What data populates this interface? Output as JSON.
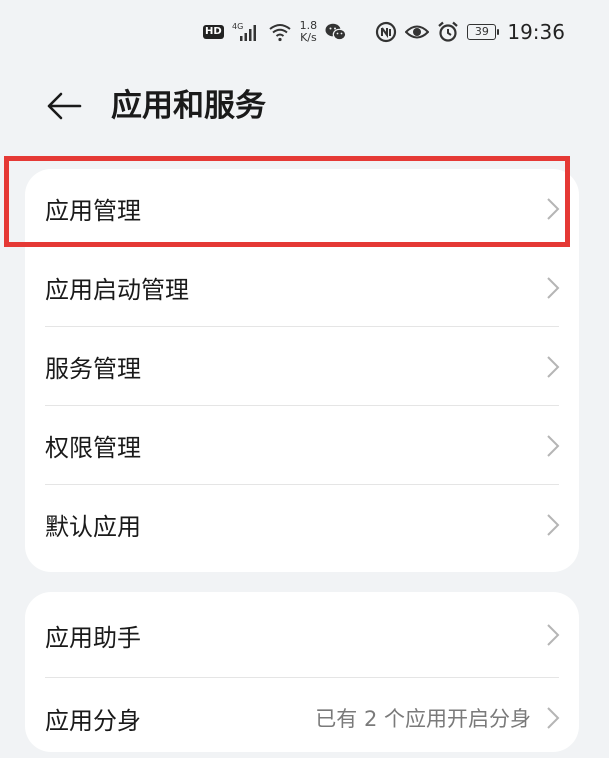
{
  "status_bar": {
    "hd": "HD",
    "network": "4G",
    "speed_value": "1.8",
    "speed_unit": "K/s",
    "battery": "39",
    "time": "19:36"
  },
  "header": {
    "title": "应用和服务",
    "back_icon": "arrow-left-icon"
  },
  "group1": {
    "items": [
      {
        "label": "应用管理"
      },
      {
        "label": "应用启动管理"
      },
      {
        "label": "服务管理"
      },
      {
        "label": "权限管理"
      },
      {
        "label": "默认应用"
      }
    ]
  },
  "group2": {
    "items": [
      {
        "label": "应用助手"
      },
      {
        "label": "应用分身",
        "value": "已有 2 个应用开启分身"
      }
    ]
  },
  "colors": {
    "background": "#f1f3f5",
    "card": "#ffffff",
    "highlight": "#e53935",
    "secondary_text": "#7a7a7a"
  }
}
